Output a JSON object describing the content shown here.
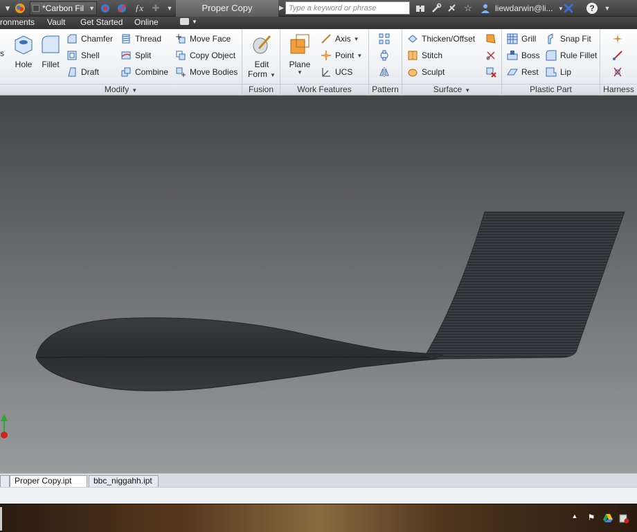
{
  "titlebar": {
    "material": "*Carbon Fil",
    "document_title": "Proper Copy",
    "search_placeholder": "Type a keyword or phrase",
    "user": "liewdarwin@li..."
  },
  "menu": [
    "ronments",
    "Vault",
    "Get Started",
    "Online"
  ],
  "ribbon": {
    "modify": {
      "label": "Modify",
      "big": [
        "Hole",
        "Fillet"
      ],
      "col1": [
        "Chamfer",
        "Shell",
        "Draft"
      ],
      "col2": [
        "Thread",
        "Split",
        "Combine"
      ],
      "col3": [
        "Move Face",
        "Copy Object",
        "Move Bodies"
      ]
    },
    "fusion": {
      "label": "Fusion",
      "edit_form": "Edit",
      "edit_form2": "Form"
    },
    "work_features": {
      "label": "Work Features",
      "plane": "Plane",
      "items": [
        "Axis",
        "Point",
        "UCS"
      ]
    },
    "pattern": {
      "label": "Pattern"
    },
    "surface": {
      "label": "Surface",
      "items": [
        "Thicken/Offset",
        "Stitch",
        "Sculpt"
      ]
    },
    "plastic_part": {
      "label": "Plastic Part",
      "col1": [
        "Grill",
        "Boss",
        "Rest"
      ],
      "col2": [
        "Snap Fit",
        "Rule Fillet",
        "Lip"
      ]
    },
    "harness": {
      "label": "Harness"
    }
  },
  "tabs": [
    "Proper Copy.ipt",
    "bbc_niggahh.ipt"
  ],
  "colors": {
    "accent": "#2f6fc4",
    "model": "#2f3034"
  }
}
